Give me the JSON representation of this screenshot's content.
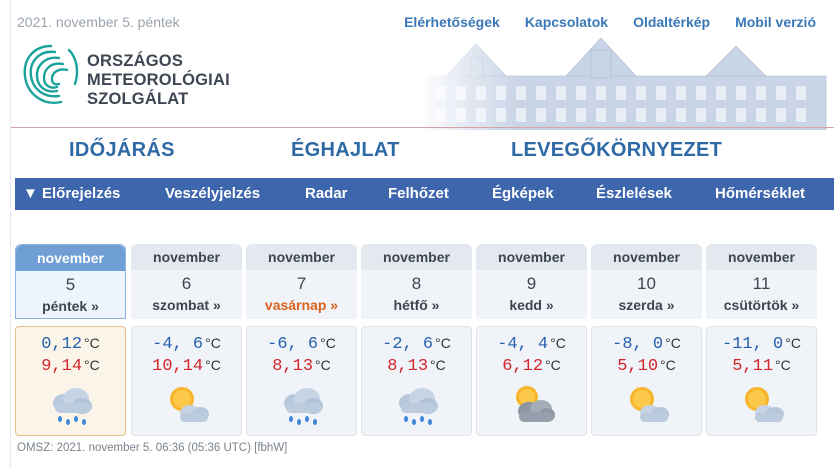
{
  "header": {
    "date": "2021. november 5. péntek",
    "links": [
      "Elérhetőségek",
      "Kapcsolatok",
      "Oldaltérkép",
      "Mobil verzió"
    ]
  },
  "logo": {
    "line1": "ORSZÁGOS",
    "line2": "METEOROLÓGIAI",
    "line3": "SZOLGÁLAT"
  },
  "main_nav": [
    "IDŐJÁRÁS",
    "ÉGHAJLAT",
    "LEVEGŐKÖRNYEZET"
  ],
  "sub_nav": [
    "▼ Előrejelzés",
    "Veszélyjelzés",
    "Radar",
    "Felhőzet",
    "Égképek",
    "Észlelések",
    "Hőmérséklet"
  ],
  "days": [
    {
      "month": "november",
      "day": "5",
      "weekday": "péntek »",
      "min": "0,12",
      "max": "9,14",
      "icon": "rain-cloud-icon"
    },
    {
      "month": "november",
      "day": "6",
      "weekday": "szombat »",
      "min": "-4, 6",
      "max": "10,14",
      "icon": "sun-cloud-icon"
    },
    {
      "month": "november",
      "day": "7",
      "weekday": "vasárnap »",
      "min": "-6, 6",
      "max": "8,13",
      "icon": "rain-cloud-icon"
    },
    {
      "month": "november",
      "day": "8",
      "weekday": "hétfő »",
      "min": "-2, 6",
      "max": "8,13",
      "icon": "rain-cloud-icon"
    },
    {
      "month": "november",
      "day": "9",
      "weekday": "kedd »",
      "min": "-4, 4",
      "max": "6,12",
      "icon": "sun-dark-cloud-icon"
    },
    {
      "month": "november",
      "day": "10",
      "weekday": "szerda »",
      "min": "-8, 0",
      "max": "5,10",
      "icon": "sun-cloud-icon"
    },
    {
      "month": "november",
      "day": "11",
      "weekday": "csütörtök »",
      "min": "-11, 0",
      "max": "5,11",
      "icon": "sun-cloud-icon"
    }
  ],
  "unit": "°C",
  "footer": "OMSZ: 2021. november 5. 06:36 (05:36 UTC) [fbhW]",
  "colors": {
    "accent": "#3d66ad",
    "min_temp": "#2861b0",
    "max_temp": "#d3262c",
    "sunday": "#d9621e"
  }
}
